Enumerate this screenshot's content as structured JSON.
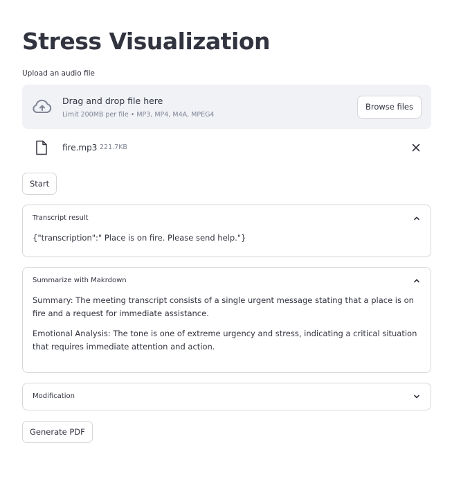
{
  "page": {
    "title": "Stress Visualization"
  },
  "uploader": {
    "label": "Upload an audio file",
    "drop_title": "Drag and drop file here",
    "limit_text": "Limit 200MB per file • MP3, MP4, M4A, MPEG4",
    "browse_label": "Browse files",
    "file": {
      "name": "fire.mp3",
      "size": "221.7KB"
    }
  },
  "actions": {
    "start_label": "Start",
    "generate_pdf_label": "Generate PDF"
  },
  "expanders": {
    "transcript": {
      "title": "Transcript result",
      "content": "{\"transcription\":\" Place is on fire. Please send help.\"}",
      "expanded": true
    },
    "summary": {
      "title": "Summarize with Makrdown",
      "summary_text": "Summary: The meeting transcript consists of a single urgent message stating that a place is on fire and a request for immediate assistance.",
      "emotion_text": "Emotional Analysis: The tone is one of extreme urgency and stress, indicating a critical situation that requires immediate attention and action.",
      "expanded": true
    },
    "modification": {
      "title": "Modification",
      "expanded": false
    }
  },
  "icons": {
    "upload": "cloud-upload-icon",
    "file": "file-icon",
    "close": "close-icon",
    "collapse": "chevron-up-icon",
    "expand": "chevron-down-icon"
  },
  "colors": {
    "text": "#31333f",
    "muted": "#808495",
    "dropzone_bg": "#f0f2f6",
    "border": "#d6d6d9"
  }
}
